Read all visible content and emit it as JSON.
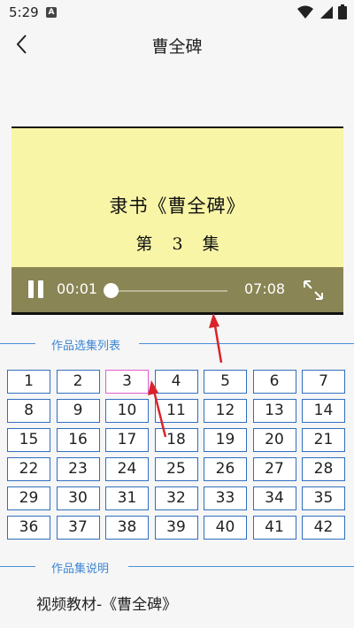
{
  "status_bar": {
    "time": "5:29",
    "notification_badge": "A",
    "icons": [
      "wifi-icon",
      "signal-icon",
      "battery-icon"
    ]
  },
  "header": {
    "title": "曹全碑",
    "back_icon": "chevron-left-icon"
  },
  "player": {
    "video_title": "隶书《曹全碑》",
    "episode_prefix": "第",
    "episode_number": "3",
    "episode_suffix": "集",
    "current_time": "00:01",
    "total_time": "07:08",
    "progress": 0.002,
    "state": "playing"
  },
  "episodes_section": {
    "title": "作品选集列表",
    "selected": 3,
    "items": [
      "1",
      "2",
      "3",
      "4",
      "5",
      "6",
      "7",
      "8",
      "9",
      "10",
      "11",
      "12",
      "13",
      "14",
      "15",
      "16",
      "17",
      "18",
      "19",
      "20",
      "21",
      "22",
      "23",
      "24",
      "25",
      "26",
      "27",
      "28",
      "29",
      "30",
      "31",
      "32",
      "33",
      "34",
      "35",
      "36",
      "37",
      "38",
      "39",
      "40",
      "41",
      "42"
    ]
  },
  "description_section": {
    "title": "作品集说明",
    "text": "视频教材-《曹全碑》"
  },
  "colors": {
    "accent": "#3d86d4",
    "player_bg": "#f8f5a6",
    "controls_bg": "#8a8555",
    "selected_border": "#e25bd0",
    "annotation": "#d9232a"
  }
}
